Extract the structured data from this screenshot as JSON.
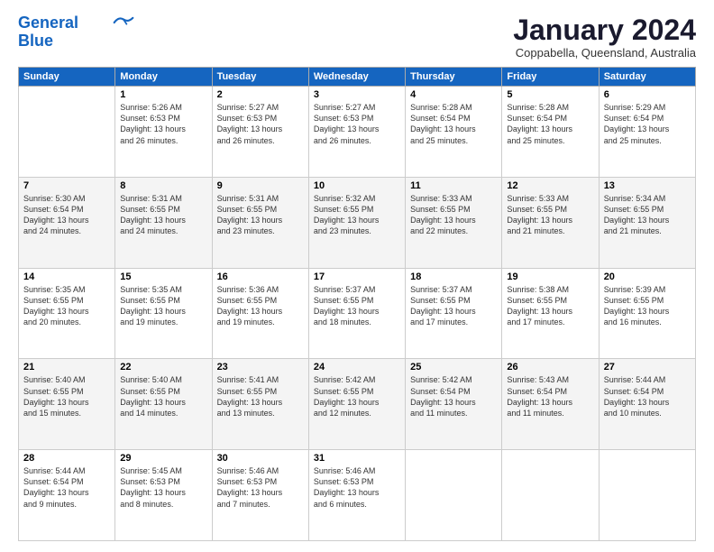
{
  "logo": {
    "line1": "General",
    "line2": "Blue"
  },
  "title": "January 2024",
  "subtitle": "Coppabella, Queensland, Australia",
  "weekdays": [
    "Sunday",
    "Monday",
    "Tuesday",
    "Wednesday",
    "Thursday",
    "Friday",
    "Saturday"
  ],
  "weeks": [
    [
      {
        "day": "",
        "info": ""
      },
      {
        "day": "1",
        "info": "Sunrise: 5:26 AM\nSunset: 6:53 PM\nDaylight: 13 hours\nand 26 minutes."
      },
      {
        "day": "2",
        "info": "Sunrise: 5:27 AM\nSunset: 6:53 PM\nDaylight: 13 hours\nand 26 minutes."
      },
      {
        "day": "3",
        "info": "Sunrise: 5:27 AM\nSunset: 6:53 PM\nDaylight: 13 hours\nand 26 minutes."
      },
      {
        "day": "4",
        "info": "Sunrise: 5:28 AM\nSunset: 6:54 PM\nDaylight: 13 hours\nand 25 minutes."
      },
      {
        "day": "5",
        "info": "Sunrise: 5:28 AM\nSunset: 6:54 PM\nDaylight: 13 hours\nand 25 minutes."
      },
      {
        "day": "6",
        "info": "Sunrise: 5:29 AM\nSunset: 6:54 PM\nDaylight: 13 hours\nand 25 minutes."
      }
    ],
    [
      {
        "day": "7",
        "info": "Sunrise: 5:30 AM\nSunset: 6:54 PM\nDaylight: 13 hours\nand 24 minutes."
      },
      {
        "day": "8",
        "info": "Sunrise: 5:31 AM\nSunset: 6:55 PM\nDaylight: 13 hours\nand 24 minutes."
      },
      {
        "day": "9",
        "info": "Sunrise: 5:31 AM\nSunset: 6:55 PM\nDaylight: 13 hours\nand 23 minutes."
      },
      {
        "day": "10",
        "info": "Sunrise: 5:32 AM\nSunset: 6:55 PM\nDaylight: 13 hours\nand 23 minutes."
      },
      {
        "day": "11",
        "info": "Sunrise: 5:33 AM\nSunset: 6:55 PM\nDaylight: 13 hours\nand 22 minutes."
      },
      {
        "day": "12",
        "info": "Sunrise: 5:33 AM\nSunset: 6:55 PM\nDaylight: 13 hours\nand 21 minutes."
      },
      {
        "day": "13",
        "info": "Sunrise: 5:34 AM\nSunset: 6:55 PM\nDaylight: 13 hours\nand 21 minutes."
      }
    ],
    [
      {
        "day": "14",
        "info": "Sunrise: 5:35 AM\nSunset: 6:55 PM\nDaylight: 13 hours\nand 20 minutes."
      },
      {
        "day": "15",
        "info": "Sunrise: 5:35 AM\nSunset: 6:55 PM\nDaylight: 13 hours\nand 19 minutes."
      },
      {
        "day": "16",
        "info": "Sunrise: 5:36 AM\nSunset: 6:55 PM\nDaylight: 13 hours\nand 19 minutes."
      },
      {
        "day": "17",
        "info": "Sunrise: 5:37 AM\nSunset: 6:55 PM\nDaylight: 13 hours\nand 18 minutes."
      },
      {
        "day": "18",
        "info": "Sunrise: 5:37 AM\nSunset: 6:55 PM\nDaylight: 13 hours\nand 17 minutes."
      },
      {
        "day": "19",
        "info": "Sunrise: 5:38 AM\nSunset: 6:55 PM\nDaylight: 13 hours\nand 17 minutes."
      },
      {
        "day": "20",
        "info": "Sunrise: 5:39 AM\nSunset: 6:55 PM\nDaylight: 13 hours\nand 16 minutes."
      }
    ],
    [
      {
        "day": "21",
        "info": "Sunrise: 5:40 AM\nSunset: 6:55 PM\nDaylight: 13 hours\nand 15 minutes."
      },
      {
        "day": "22",
        "info": "Sunrise: 5:40 AM\nSunset: 6:55 PM\nDaylight: 13 hours\nand 14 minutes."
      },
      {
        "day": "23",
        "info": "Sunrise: 5:41 AM\nSunset: 6:55 PM\nDaylight: 13 hours\nand 13 minutes."
      },
      {
        "day": "24",
        "info": "Sunrise: 5:42 AM\nSunset: 6:55 PM\nDaylight: 13 hours\nand 12 minutes."
      },
      {
        "day": "25",
        "info": "Sunrise: 5:42 AM\nSunset: 6:54 PM\nDaylight: 13 hours\nand 11 minutes."
      },
      {
        "day": "26",
        "info": "Sunrise: 5:43 AM\nSunset: 6:54 PM\nDaylight: 13 hours\nand 11 minutes."
      },
      {
        "day": "27",
        "info": "Sunrise: 5:44 AM\nSunset: 6:54 PM\nDaylight: 13 hours\nand 10 minutes."
      }
    ],
    [
      {
        "day": "28",
        "info": "Sunrise: 5:44 AM\nSunset: 6:54 PM\nDaylight: 13 hours\nand 9 minutes."
      },
      {
        "day": "29",
        "info": "Sunrise: 5:45 AM\nSunset: 6:53 PM\nDaylight: 13 hours\nand 8 minutes."
      },
      {
        "day": "30",
        "info": "Sunrise: 5:46 AM\nSunset: 6:53 PM\nDaylight: 13 hours\nand 7 minutes."
      },
      {
        "day": "31",
        "info": "Sunrise: 5:46 AM\nSunset: 6:53 PM\nDaylight: 13 hours\nand 6 minutes."
      },
      {
        "day": "",
        "info": ""
      },
      {
        "day": "",
        "info": ""
      },
      {
        "day": "",
        "info": ""
      }
    ]
  ]
}
